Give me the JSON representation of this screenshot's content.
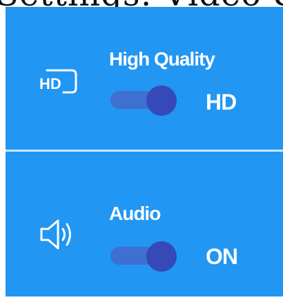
{
  "header_fragment": "Settings: Video & Audio",
  "quality": {
    "icon": "hd-icon",
    "icon_text": "HD",
    "label": "High Quality",
    "toggle_on": true,
    "state": "HD"
  },
  "audio": {
    "icon": "speaker-icon",
    "label": "Audio",
    "toggle_on": true,
    "state": "ON"
  },
  "colors": {
    "panel": "#2196f3",
    "track": "#3f6fd0",
    "knob": "#3649b8",
    "divider": "#cfe6fb",
    "text": "#ffffff"
  }
}
